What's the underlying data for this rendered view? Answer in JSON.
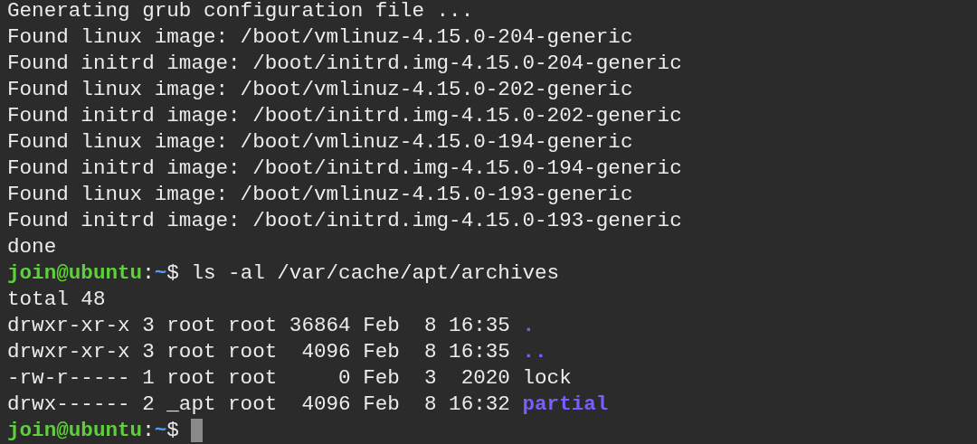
{
  "output": [
    "Generating grub configuration file ...",
    "Found linux image: /boot/vmlinuz-4.15.0-204-generic",
    "Found initrd image: /boot/initrd.img-4.15.0-204-generic",
    "Found linux image: /boot/vmlinuz-4.15.0-202-generic",
    "Found initrd image: /boot/initrd.img-4.15.0-202-generic",
    "Found linux image: /boot/vmlinuz-4.15.0-194-generic",
    "Found initrd image: /boot/initrd.img-4.15.0-194-generic",
    "Found linux image: /boot/vmlinuz-4.15.0-193-generic",
    "Found initrd image: /boot/initrd.img-4.15.0-193-generic",
    "done"
  ],
  "prompt": {
    "user": "join@ubuntu",
    "separator": ":",
    "path": "~",
    "symbol": "$",
    "command": "ls -al /var/cache/apt/archives"
  },
  "total": "total 48",
  "entries": [
    {
      "details": "drwxr-xr-x 3 root root 36864 Feb  8 16:35",
      "name": ".",
      "kind": "dir"
    },
    {
      "details": "drwxr-xr-x 3 root root  4096 Feb  8 16:35",
      "name": "..",
      "kind": "dir"
    },
    {
      "details": "-rw-r----- 1 root root     0 Feb  3  2020",
      "name": "lock",
      "kind": "file"
    },
    {
      "details": "drwx------ 2 _apt root  4096 Feb  8 16:32",
      "name": "partial",
      "kind": "dir"
    }
  ],
  "final_prompt": {
    "user": "join@ubuntu",
    "separator": ":",
    "path": "~",
    "symbol": "$",
    "cursor": true
  }
}
